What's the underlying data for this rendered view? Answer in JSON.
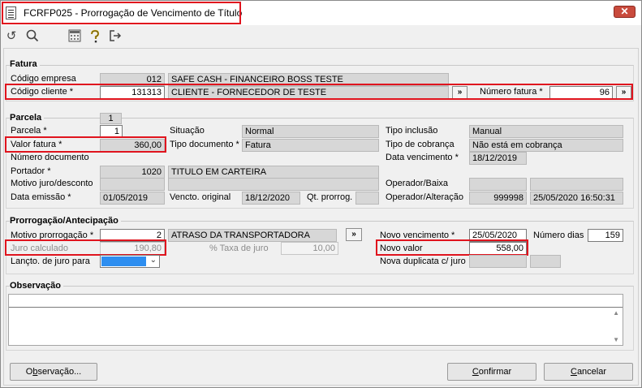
{
  "window": {
    "title": "FCRFP025 - Prorrogação de Vencimento de Título",
    "close_label": "✕"
  },
  "toolbar": {
    "icons": [
      "undo-icon",
      "search-icon",
      "calculator-icon",
      "help-icon",
      "exit-icon"
    ]
  },
  "fatura": {
    "group_title": "Fatura",
    "codigo_empresa_label": "Código empresa",
    "codigo_empresa": "012",
    "empresa_nome": "SAFE CASH - FINANCEIRO BOSS TESTE",
    "codigo_cliente_label": "Código cliente *",
    "codigo_cliente": "131313",
    "cliente_nome": "CLIENTE - FORNECEDOR DE TESTE",
    "numero_fatura_label": "Número fatura *",
    "numero_fatura": "96",
    "lookup_btn": "»"
  },
  "parcela": {
    "group_title": "Parcela",
    "parcela_count": "1",
    "parcela_label": "Parcela *",
    "parcela": "1",
    "valor_fatura_label": "Valor fatura *",
    "valor_fatura": "360,00",
    "numero_documento_label": "Número documento",
    "numero_documento": "",
    "portador_label": "Portador *",
    "portador": "1020",
    "portador_nome": "TITULO EM CARTEIRA",
    "motivo_juro_label": "Motivo juro/desconto",
    "motivo_juro": "",
    "motivo_juro_desc": "",
    "data_emissao_label": "Data emissão *",
    "data_emissao": "01/05/2019",
    "situacao_label": "Situação",
    "situacao": "Normal",
    "tipo_documento_label": "Tipo documento *",
    "tipo_documento": "Fatura",
    "vencto_original_label": "Vencto. original",
    "vencto_original": "18/12/2020",
    "qt_prorrog_label": "Qt. prorrog.",
    "qt_prorrog": "",
    "tipo_inclusao_label": "Tipo inclusão",
    "tipo_inclusao": "Manual",
    "tipo_cobranca_label": "Tipo de cobrança",
    "tipo_cobranca": "Não está em cobrança",
    "data_vencimento_label": "Data vencimento *",
    "data_vencimento": "18/12/2019",
    "operador_baixa_label": "Operador/Baixa",
    "operador_baixa": "",
    "operador_baixa_data": "",
    "operador_alteracao_label": "Operador/Alteração",
    "operador_alteracao": "999998",
    "operador_alteracao_data": "25/05/2020 16:50:31"
  },
  "prorrogacao": {
    "group_title": "Prorrogação/Antecipação",
    "motivo_label": "Motivo prorrogação *",
    "motivo": "2",
    "motivo_desc": "ATRASO DA TRANSPORTADORA",
    "juro_calculado_label": "Juro calculado",
    "juro_calculado": "190,80",
    "taxa_juro_label": "% Taxa de juro",
    "taxa_juro": "10,00",
    "lancto_juro_label": "Lançto. de juro para",
    "novo_vencimento_label": "Novo vencimento *",
    "novo_vencimento": "25/05/2020",
    "numero_dias_label": "Número dias",
    "numero_dias": "159",
    "novo_valor_label": "Novo valor",
    "novo_valor": "558,00",
    "nova_duplicata_label": "Nova duplicata c/ juro",
    "nova_duplicata": "",
    "nova_duplicata_extra": "",
    "lookup_btn": "»"
  },
  "observacao": {
    "group_title": "Observação",
    "text": ""
  },
  "buttons": {
    "observacao_pre": "O",
    "observacao_u": "b",
    "observacao_post": "servação...",
    "confirmar_pre": "",
    "confirmar_u": "C",
    "confirmar_post": "onfirmar",
    "cancelar_pre": "",
    "cancelar_u": "C",
    "cancelar_post": "ancelar"
  }
}
